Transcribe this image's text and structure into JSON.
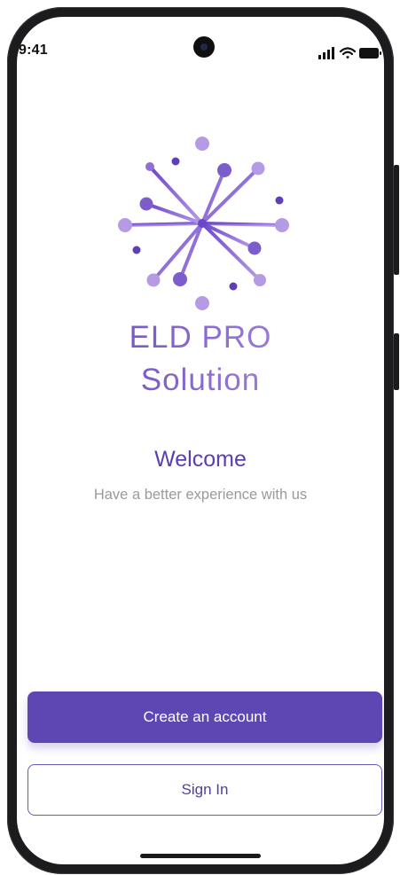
{
  "status_bar": {
    "time": "9:41",
    "icons": [
      "signal-icon",
      "wifi-icon",
      "battery-icon"
    ]
  },
  "logo": {
    "icon": "network-burst-logo-icon",
    "brand_line_1": "ELD PRO",
    "brand_line_2": "Solution"
  },
  "welcome": {
    "title": "Welcome",
    "subtitle": "Have a better experience with us"
  },
  "actions": {
    "create_account_label": "Create an account",
    "sign_in_label": "Sign In"
  },
  "colors": {
    "primary": "#5e47b2",
    "logo_gradient_start": "#5f3fb7",
    "logo_gradient_end": "#b595e9",
    "subtitle": "#9a9a9a",
    "background": "#ffffff"
  }
}
